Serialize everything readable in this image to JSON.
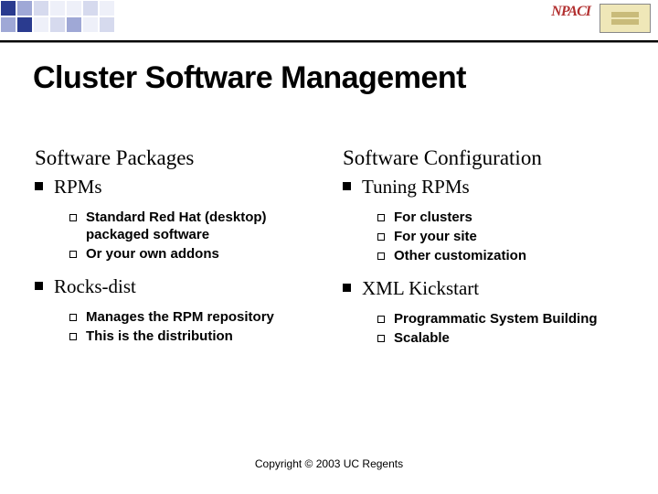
{
  "logo_text": "NPACI",
  "title": "Cluster Software Management",
  "left": {
    "heading": "Software Packages",
    "items": [
      {
        "label": "RPMs",
        "sub": [
          "Standard Red Hat (desktop) packaged software",
          "Or your own addons"
        ]
      },
      {
        "label": "Rocks-dist",
        "sub": [
          "Manages the RPM repository",
          "This is the distribution"
        ]
      }
    ]
  },
  "right": {
    "heading": "Software Configuration",
    "items": [
      {
        "label": "Tuning RPMs",
        "sub": [
          "For clusters",
          "For your site",
          "Other customization"
        ]
      },
      {
        "label": "XML Kickstart",
        "sub": [
          "Programmatic System Building",
          "Scalable"
        ]
      }
    ]
  },
  "footer": "Copyright © 2003 UC Regents"
}
